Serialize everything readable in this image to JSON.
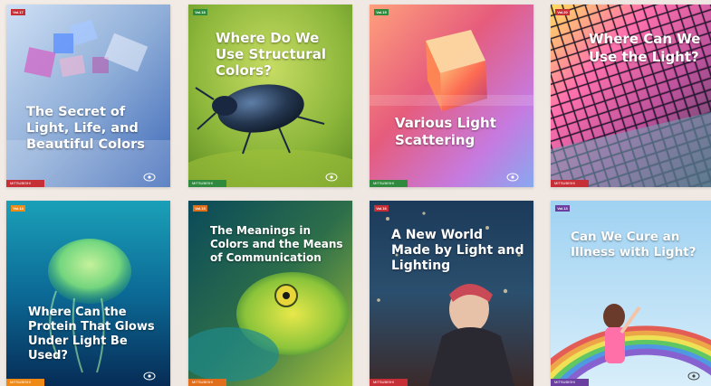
{
  "cards": [
    {
      "tag": "Vol.17",
      "title": "The Secret of Light, Life, and Beautiful Colors",
      "footer": "MITSUBISHI CHEMICAL",
      "color": "#c62f36"
    },
    {
      "tag": "Vol.18",
      "title": "Where Do We Use Structural Colors?",
      "footer": "MITSUBISHI CHEMICAL",
      "color": "#2f8a3e"
    },
    {
      "tag": "Vol.19",
      "title": "Various Light Scattering",
      "footer": "MITSUBISHI CHEMICAL",
      "color": "#2f8a3e"
    },
    {
      "tag": "Vol.20",
      "title": "Where Can We Use the Light?",
      "footer": "MITSUBISHI CHEMICAL",
      "color": "#c62f36"
    },
    {
      "tag": "Vol.14",
      "title": "Where Can the Protein That Glows Under Light Be Used?",
      "footer": "MITSUBISHI CHEMICAL",
      "color": "#f08a16"
    },
    {
      "tag": "Vol.15",
      "title": "The Meanings in Colors and the Means of Communication",
      "footer": "MITSUBISHI CHEMICAL",
      "color": "#e06e1b"
    },
    {
      "tag": "Vol.16",
      "title": "A New World Made by Light and Lighting",
      "footer": "MITSUBISHI CHEMICAL",
      "color": "#c62f36"
    },
    {
      "tag": "Vol.13",
      "title": "Can We Cure an Illness with Light?",
      "footer": "MITSUBISHI CHEMICAL",
      "color": "#6b3fa0"
    }
  ]
}
